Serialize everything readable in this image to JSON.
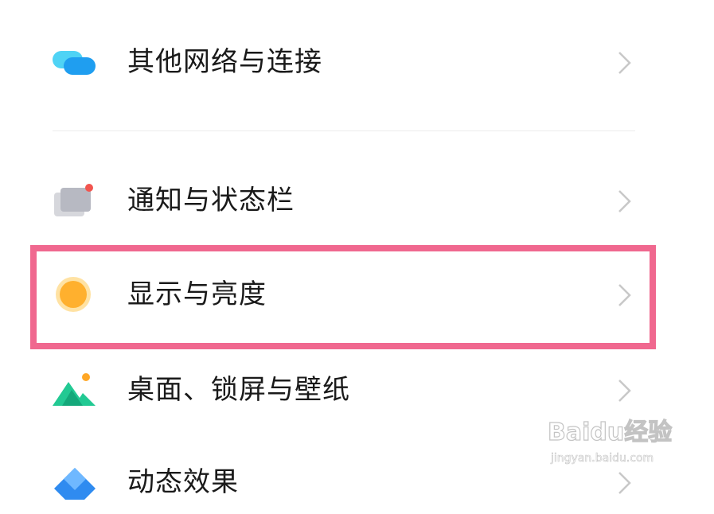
{
  "settings": {
    "items": [
      {
        "label": "其他网络与连接",
        "icon": "network-connection-icon"
      },
      {
        "label": "通知与状态栏",
        "icon": "notification-statusbar-icon"
      },
      {
        "label": "显示与亮度",
        "icon": "display-brightness-icon"
      },
      {
        "label": "桌面、锁屏与壁纸",
        "icon": "wallpaper-icon"
      },
      {
        "label": "动态效果",
        "icon": "animation-effects-icon"
      }
    ],
    "chevron_icon": "chevron-right-icon"
  },
  "colors": {
    "highlight_border": "#f0688f",
    "text": "#1a1a1a",
    "chevron": "#c8c8c8",
    "divider": "#ececec"
  },
  "watermark": {
    "logo": "Baidu经验",
    "url": "jingyan.baidu.com"
  }
}
